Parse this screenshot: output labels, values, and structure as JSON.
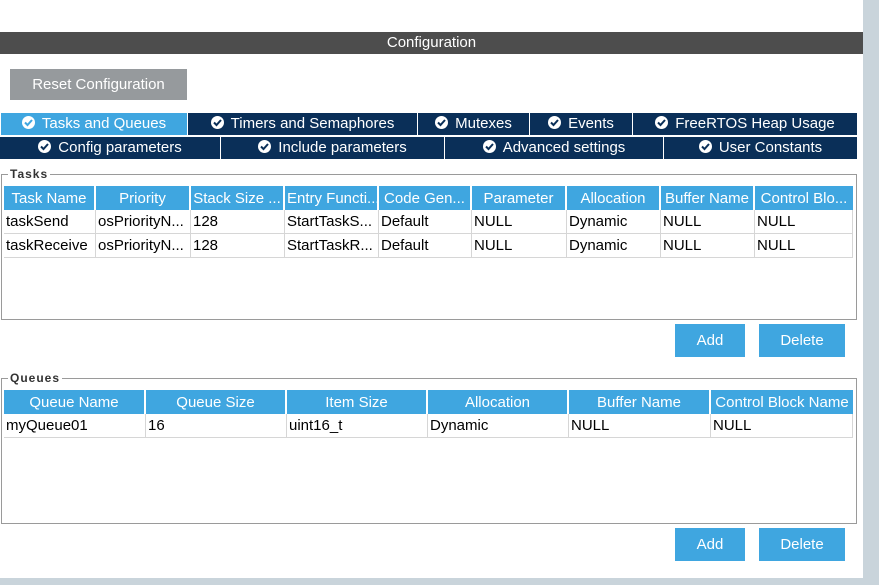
{
  "header": {
    "title": "Configuration"
  },
  "reset_button": "Reset Configuration",
  "tabs_row1": [
    {
      "label": "Tasks and Queues",
      "active": true
    },
    {
      "label": "Timers and Semaphores",
      "active": false
    },
    {
      "label": "Mutexes",
      "active": false
    },
    {
      "label": "Events",
      "active": false
    },
    {
      "label": "FreeRTOS Heap Usage",
      "active": false
    }
  ],
  "tabs_row2": [
    {
      "label": "Config parameters"
    },
    {
      "label": "Include parameters"
    },
    {
      "label": "Advanced settings"
    },
    {
      "label": "User Constants"
    }
  ],
  "tasks": {
    "legend": "Tasks",
    "columns": [
      "Task Name",
      "Priority",
      "Stack Size ...",
      "Entry Functi...",
      "Code Gen...",
      "Parameter",
      "Allocation",
      "Buffer Name",
      "Control Blo..."
    ],
    "rows": [
      [
        "taskSend",
        "osPriorityN...",
        "128",
        "StartTaskS...",
        "Default",
        "NULL",
        "Dynamic",
        "NULL",
        "NULL"
      ],
      [
        "taskReceive",
        "osPriorityN...",
        "128",
        "StartTaskR...",
        "Default",
        "NULL",
        "Dynamic",
        "NULL",
        "NULL"
      ]
    ],
    "add": "Add",
    "delete": "Delete"
  },
  "queues": {
    "legend": "Queues",
    "columns": [
      "Queue Name",
      "Queue Size",
      "Item Size",
      "Allocation",
      "Buffer Name",
      "Control Block Name"
    ],
    "rows": [
      [
        "myQueue01",
        "16",
        "uint16_t",
        "Dynamic",
        "NULL",
        "NULL"
      ]
    ],
    "add": "Add",
    "delete": "Delete"
  },
  "colors": {
    "accent": "#3fa6e0",
    "tab_dark": "#0a2f58",
    "header": "#4d4d4d"
  }
}
